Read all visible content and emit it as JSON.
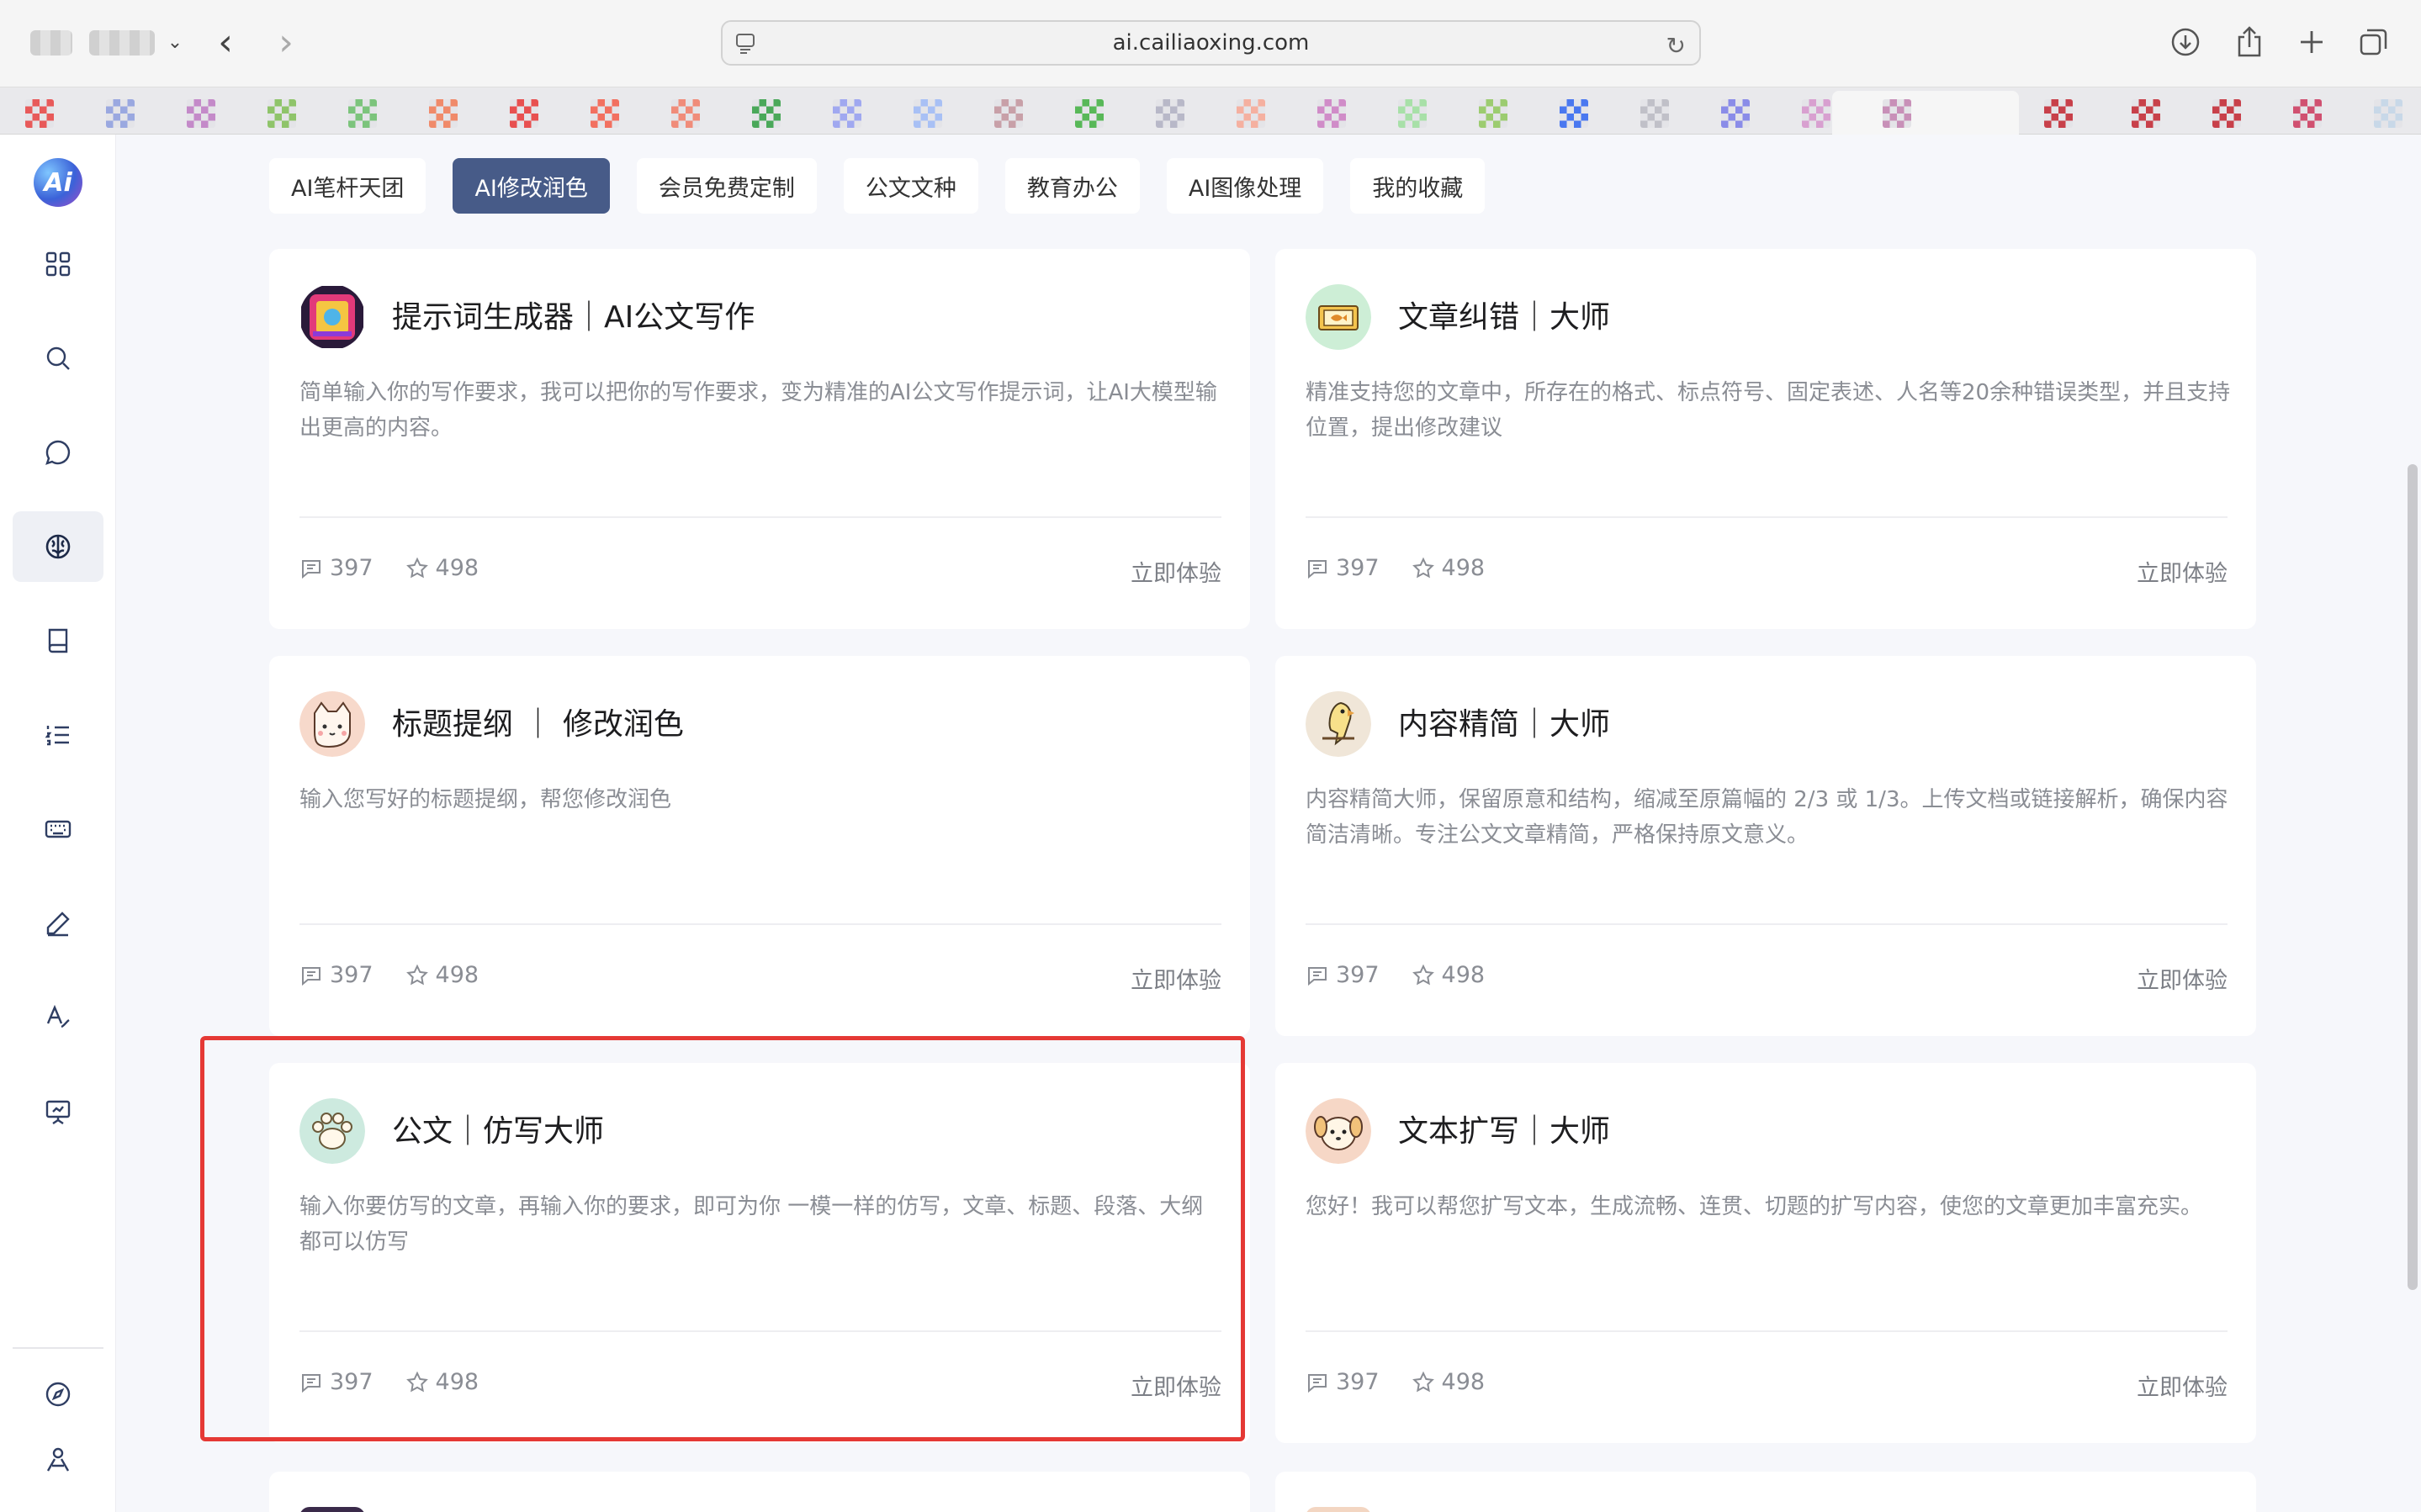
{
  "browser": {
    "url": "ai.cailiaoxing.com"
  },
  "favicon_colors": [
    "#e85a5a",
    "#9aa8e0",
    "#c48ac9",
    "#8fc46a",
    "#7cc47c",
    "#f08a6a",
    "#e85050",
    "#f27060",
    "#f08c7a",
    "#4aa85a",
    "#a0a8f0",
    "#a8c0f5",
    "#c8a0a8",
    "#58b858",
    "#b8b8c8",
    "#f5b0a0",
    "#d08cc8",
    "#a8e0a8",
    "#9ccc70",
    "#4a78f0",
    "#c0c0c8",
    "#8a8ce8",
    "#d8a0d0",
    "#c890b8",
    "#c8404a",
    "#c8404a",
    "#c8404a",
    "#d05070",
    "#c8d8e8"
  ],
  "chips": [
    {
      "label": "AI笔杆天团",
      "active": false
    },
    {
      "label": "AI修改润色",
      "active": true
    },
    {
      "label": "会员免费定制",
      "active": false
    },
    {
      "label": "公文文种",
      "active": false
    },
    {
      "label": "教育办公",
      "active": false
    },
    {
      "label": "AI图像处理",
      "active": false
    },
    {
      "label": "我的收藏",
      "active": false
    }
  ],
  "cards": [
    {
      "title": "提示词生成器｜AI公文写作",
      "desc": "简单输入你的写作要求，我可以把你的写作要求，变为精准的AI公文写作提示词，让AI大模型输出更高的内容。",
      "comments": "397",
      "stars": "498",
      "cta": "立即体验",
      "avatar": "poster-icon"
    },
    {
      "title": "文章纠错｜大师",
      "desc": "精准支持您的文章中，所存在的格式、标点符号、固定表述、人名等20余种错误类型，并且支持位置，提出修改建议",
      "comments": "397",
      "stars": "498",
      "cta": "立即体验",
      "avatar": "fish-ticket-icon"
    },
    {
      "title": "标题提纲 ｜ 修改润色",
      "desc": "输入您写好的标题提纲，帮您修改润色",
      "comments": "397",
      "stars": "498",
      "cta": "立即体验",
      "avatar": "cat-icon"
    },
    {
      "title": "内容精简｜大师",
      "desc": "内容精简大师，保留原意和结构，缩减至原篇幅的 2/3 或 1/3。上传文档或链接解析，确保内容简洁清晰。专注公文文章精简，严格保持原文意义。",
      "comments": "397",
      "stars": "498",
      "cta": "立即体验",
      "avatar": "parrot-icon"
    },
    {
      "title": "公文｜仿写大师",
      "desc": "输入你要仿写的文章，再输入你的要求，即可为你 一模一样的仿写，文章、标题、段落、大纲都可以仿写",
      "comments": "397",
      "stars": "498",
      "cta": "立即体验",
      "avatar": "paw-icon"
    },
    {
      "title": "文本扩写｜大师",
      "desc": "您好！我可以帮您扩写文本，生成流畅、连贯、切题的扩写内容，使您的文章更加丰富充实。",
      "comments": "397",
      "stars": "498",
      "cta": "立即体验",
      "avatar": "dog-icon"
    }
  ],
  "rail": {
    "logo_text": "Ai",
    "items": [
      "grid-icon",
      "search-icon",
      "chat-icon",
      "brain-icon",
      "book-icon",
      "list-icon",
      "keyboard-icon",
      "pen-icon",
      "text-style-icon",
      "presentation-icon",
      "compass-icon",
      "user-pen-icon"
    ]
  },
  "colors": {
    "chip_active_bg": "#475b88",
    "highlight": "#e53935"
  }
}
